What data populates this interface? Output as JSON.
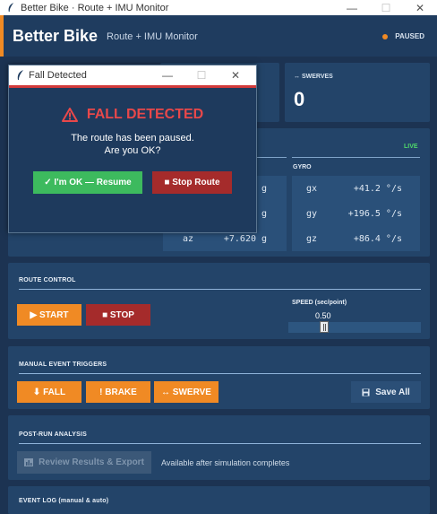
{
  "window": {
    "title": "Better Bike · Route + IMU Monitor",
    "min": "—",
    "max": "☐",
    "close": "✕"
  },
  "header": {
    "brand": "Better Bike",
    "subtitle": "Route + IMU Monitor",
    "status": "PAUSED",
    "status_color": "#f08a24"
  },
  "stats": {
    "swerves_label": "↔ SWERVES",
    "swerves_value": "0"
  },
  "imu": {
    "live_label": "LIVE",
    "gyro_label": "GYRO",
    "accel_units": [
      "g",
      "g",
      "g"
    ],
    "accel_rows": [
      {
        "axis": "az",
        "value": "+7.620"
      }
    ],
    "gyro_rows": [
      {
        "axis": "gx",
        "value": "+41.2 °/s"
      },
      {
        "axis": "gy",
        "value": "+196.5 °/s"
      },
      {
        "axis": "gz",
        "value": "+86.4 °/s"
      }
    ]
  },
  "route_control": {
    "title": "ROUTE CONTROL",
    "start": "▶  START",
    "stop": "■  STOP",
    "speed_label": "SPEED (sec/point)",
    "speed_value": "0.50"
  },
  "manual_triggers": {
    "title": "MANUAL EVENT TRIGGERS",
    "fall": "⬇  FALL",
    "brake": "!  BRAKE",
    "swerve": "↔  SWERVE",
    "save_all": "Save All"
  },
  "post_run": {
    "title": "POST-RUN ANALYSIS",
    "review": "Review Results & Export",
    "note": "Available after simulation completes"
  },
  "event_log": {
    "title": "EVENT LOG (manual & auto)"
  },
  "dialog": {
    "title": "Fall Detected",
    "heading": "FALL DETECTED",
    "line1": "The route has been paused.",
    "line2": "Are you OK?",
    "ok": "✓  I'm OK — Resume",
    "stop": "■  Stop Route",
    "min": "—",
    "max": "☐",
    "close": "✕"
  }
}
